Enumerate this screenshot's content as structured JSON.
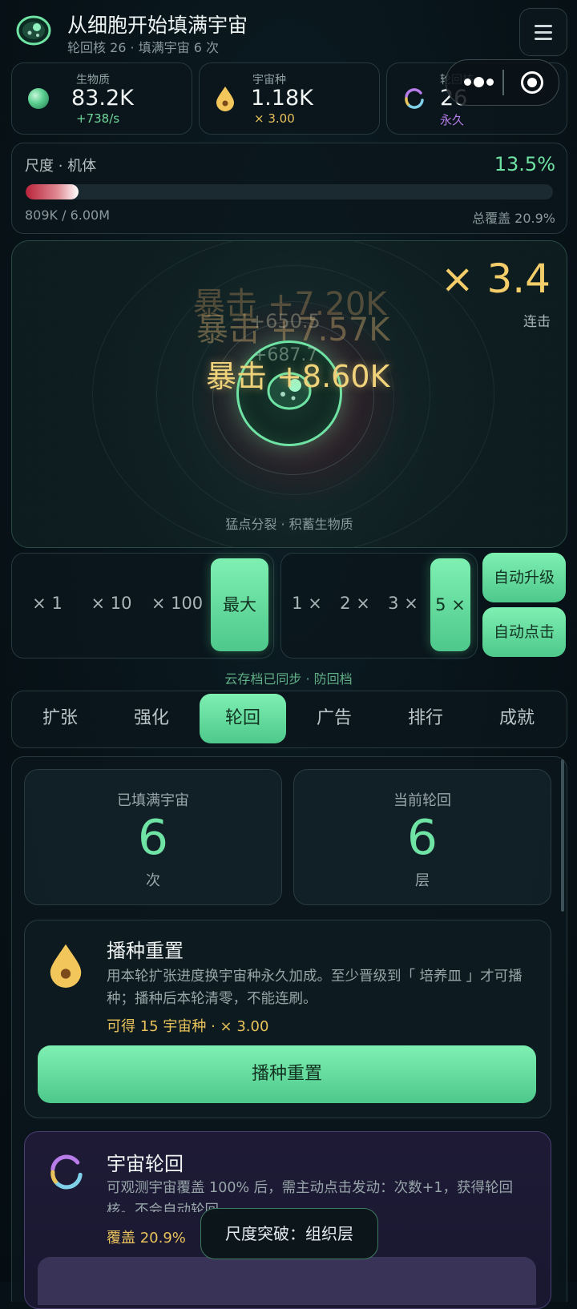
{
  "header": {
    "title": "从细胞开始填满宇宙",
    "subtitle": "轮回核 26 · 填满宇宙 6 次"
  },
  "stats": [
    {
      "label": "生物质",
      "value": "83.2K",
      "sub": "+738/s",
      "icon": "biomass-orb-icon",
      "sub_color": "#6fd79b"
    },
    {
      "label": "宇宙种",
      "value": "1.18K",
      "sub": "× 3.00",
      "icon": "seed-drop-icon",
      "sub_color": "#e8c25a"
    },
    {
      "label": "轮回核",
      "value": "26",
      "sub": "永久",
      "icon": "cycle-icon",
      "sub_color": "#b77ce8"
    }
  ],
  "capsule": {
    "more_icon": "more-dots-icon",
    "close_icon": "target-close-icon"
  },
  "scale": {
    "label": "尺度 · 机体",
    "percent_text": "13.5%",
    "progress": 0.135,
    "amount": "809K / 6.00M",
    "coverage": "总覆盖 20.9%"
  },
  "tap_area": {
    "multiplier": "× 3.4",
    "combo_label": "连击",
    "hint": "猛点分裂 · 积蓄生物质",
    "floats": [
      {
        "text": "暴击 +7.20K",
        "opacity": 0.35
      },
      {
        "text": "暴击 +7.57K",
        "opacity": 0.45
      },
      {
        "text": "+650.5",
        "opacity": 0.4
      },
      {
        "text": "+687.7",
        "opacity": 0.5
      },
      {
        "text": "暴击 +8.60K",
        "opacity": 0.95
      }
    ]
  },
  "buy_amounts": [
    "× 1",
    "× 10",
    "× 100",
    "最大"
  ],
  "speed_options": [
    "1 ×",
    "2 ×",
    "3 ×",
    "5 ×"
  ],
  "auto_buttons": {
    "upgrade": "自动升级",
    "tap": "自动点击"
  },
  "sync_text": "云存档已同步 · 防回档",
  "tabs": [
    "扩张",
    "强化",
    "轮回",
    "广告",
    "排行",
    "成就"
  ],
  "active_tab": "轮回",
  "cycle_stats": [
    {
      "label": "已填满宇宙",
      "value": "6",
      "unit": "次"
    },
    {
      "label": "当前轮回",
      "value": "6",
      "unit": "层"
    }
  ],
  "seed_reset": {
    "title": "播种重置",
    "desc": "用本轮扩张进度换宇宙种永久加成。至少晋级到「 培养皿 」才可播种；播种后本轮清零，不能连刷。",
    "reward": "可得 15 宇宙种 · × 3.00",
    "button": "播种重置",
    "icon": "seed-drop-icon"
  },
  "cosmic_cycle": {
    "title": "宇宙轮回",
    "desc": "可观测宇宙覆盖 100% 后，需主动点击发动：次数+1，获得轮回核。不会自动轮回。",
    "coverage": "覆盖 20.9%",
    "icon": "cycle-icon"
  },
  "toast": "尺度突破：组织层",
  "colors": {
    "accent_green": "#6fe3a4",
    "gold": "#e8c25a",
    "purple": "#b77ce8"
  }
}
